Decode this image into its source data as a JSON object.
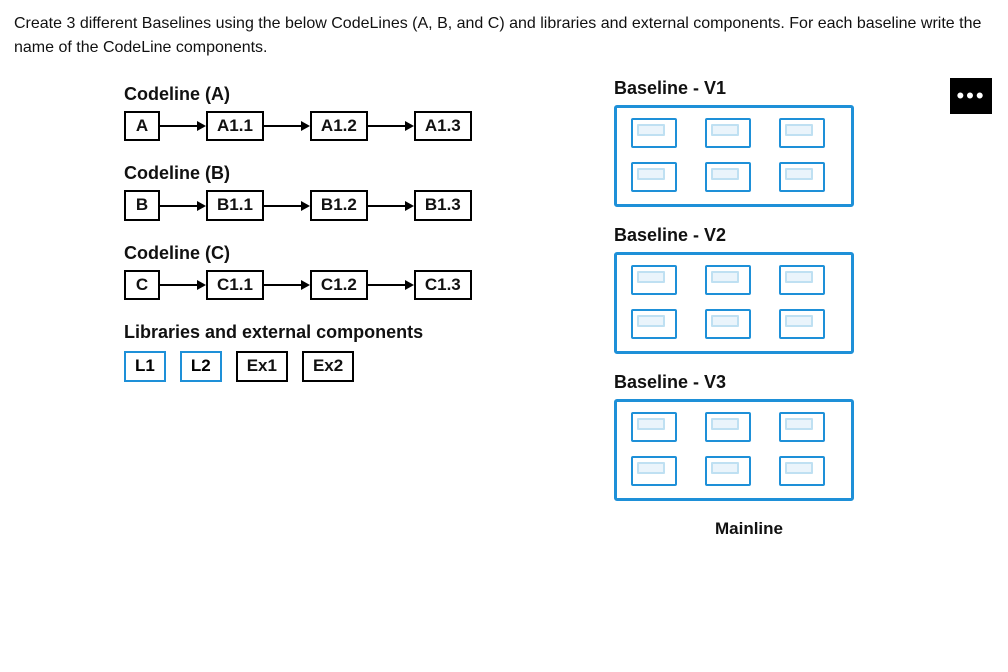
{
  "instruction": "Create 3 different Baselines using the below CodeLines (A, B, and C) and libraries and external components. For each baseline write the name of the CodeLine components.",
  "codelines": {
    "a": {
      "title": "Codeline (A)",
      "root": "A",
      "items": [
        "A1.1",
        "A1.2",
        "A1.3"
      ]
    },
    "b": {
      "title": "Codeline (B)",
      "root": "B",
      "items": [
        "B1.1",
        "B1.2",
        "B1.3"
      ]
    },
    "c": {
      "title": "Codeline (C)",
      "root": "C",
      "items": [
        "C1.1",
        "C1.2",
        "C1.3"
      ]
    }
  },
  "libs": {
    "title": "Libraries and external components",
    "items": [
      "L1",
      "L2",
      "Ex1",
      "Ex2"
    ]
  },
  "baselines": {
    "v1": "Baseline - V1",
    "v2": "Baseline - V2",
    "v3": "Baseline - V3",
    "mainline": "Mainline"
  },
  "more_label": "•••"
}
